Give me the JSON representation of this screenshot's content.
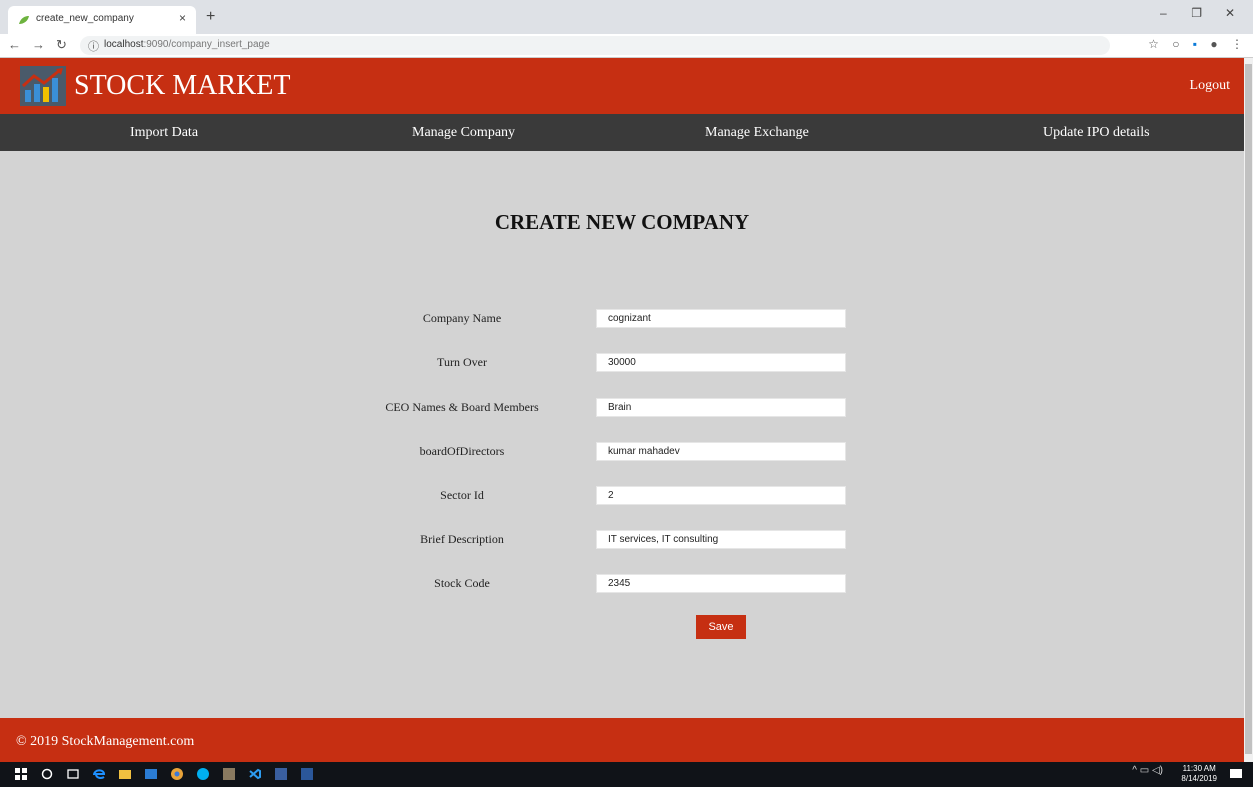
{
  "browser": {
    "tab_title": "create_new_company",
    "tab_close": "×",
    "new_tab": "+",
    "url_host": "localhost",
    "url_rest": ":9090/company_insert_page",
    "window_controls": [
      "–",
      "❐",
      "✕"
    ]
  },
  "header": {
    "brand": "STOCK MARKET",
    "logout": "Logout"
  },
  "nav": {
    "items": [
      "Import Data",
      "Manage Company",
      "Manage Exchange",
      "Update IPO details"
    ]
  },
  "form": {
    "heading": "CREATE NEW COMPANY",
    "fields": [
      {
        "label": "Company Name",
        "value": "cognizant"
      },
      {
        "label": "Turn Over",
        "value": "30000"
      },
      {
        "label": "CEO Names & Board Members",
        "value": "Brain"
      },
      {
        "label": "boardOfDirectors",
        "value": "kumar mahadev"
      },
      {
        "label": "Sector Id",
        "value": "2"
      },
      {
        "label": "Brief Description",
        "value": "IT services, IT consulting"
      },
      {
        "label": "Stock Code",
        "value": "2345"
      }
    ],
    "save_label": "Save"
  },
  "footer": {
    "copyright": "© 2019 StockManagement.com"
  },
  "taskbar": {
    "time": "11:30 AM",
    "date": "8/14/2019"
  },
  "colors": {
    "brand_red": "#c62f12",
    "nav_dark": "#3a3a3a",
    "page_bg": "#d3d3d3"
  }
}
